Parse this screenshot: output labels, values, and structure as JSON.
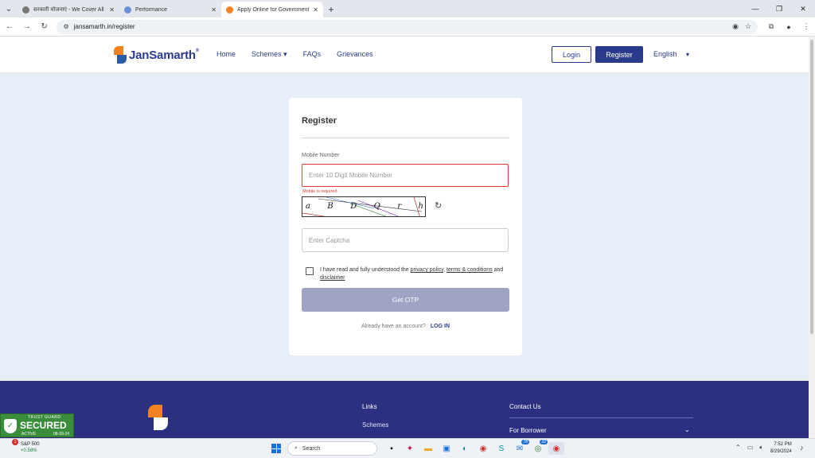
{
  "browser": {
    "tabs": [
      {
        "title": "सरकारी योजनाएं - We Cover All G",
        "active": false
      },
      {
        "title": "Performance",
        "active": false
      },
      {
        "title": "Apply Online for Government S",
        "active": true
      }
    ],
    "url": "jansamarth.in/register"
  },
  "header": {
    "logo_text": "JanSamarth",
    "logo_reg": "®",
    "nav": [
      "Home",
      "Schemes",
      "FAQs",
      "Grievances"
    ],
    "schemes_caret": "▾",
    "login_label": "Login",
    "register_label": "Register",
    "language": "English"
  },
  "form": {
    "title": "Register",
    "mobile_label": "Mobile Number",
    "mobile_placeholder": "Enter 10 Digit Mobile Number",
    "mobile_error": "Mobile is required",
    "captcha_chars": [
      "a",
      "B",
      "D",
      "Q",
      "r",
      "h"
    ],
    "captcha_placeholder": "Enter Captcha",
    "consent_prefix": "I have read and fully understood the ",
    "consent_privacy": "privacy policy",
    "consent_sep": ", ",
    "consent_terms": "terms & conditions",
    "consent_and": " and ",
    "consent_disclaimer": "disclaimer",
    "otp_button": "Get OTP",
    "already_text": "Already have an account?",
    "login_link": "LOG IN"
  },
  "footer": {
    "links_heading": "Links",
    "schemes_link": "Schemes",
    "contact_heading": "Contact Us",
    "for_borrower": "For Borrower"
  },
  "trust_badge": {
    "top": "TRUST GUARD",
    "main": "SECURED",
    "status": "ACTIVE",
    "date": "08-29-24"
  },
  "taskbar": {
    "stock_name": "S&P 500",
    "stock_change": "+0.58%",
    "stock_badge": "1",
    "search_label": "Search",
    "badge_mail": "78",
    "badge_whatsapp": "22",
    "time": "7:52 PM",
    "date": "8/29/2024"
  },
  "colors": {
    "brand": "#2b3b8c",
    "error": "#e53935",
    "footer": "#2b3080",
    "otp_disabled": "#9fa3c4"
  }
}
